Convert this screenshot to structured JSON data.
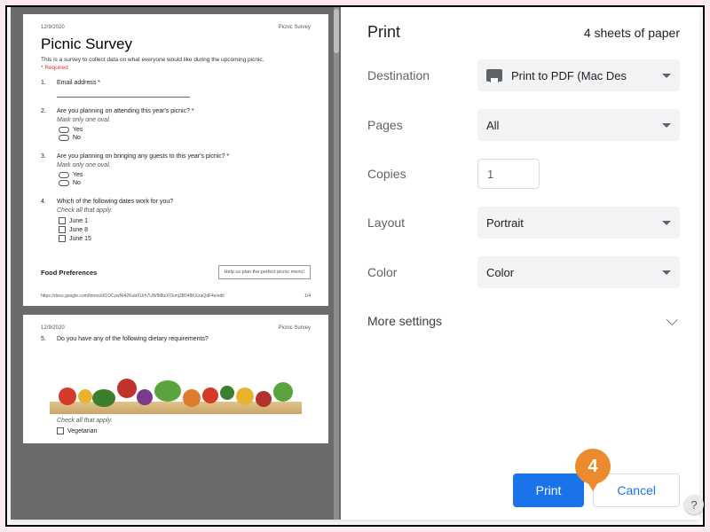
{
  "background_hint": "Are you planning on bringing any guests to this year's picnic?",
  "callout_number": "4",
  "preview": {
    "date": "12/9/2020",
    "doc_title": "Picnic Survey",
    "title": "Picnic Survey",
    "description": "This is a survey to collect data on what everyone would like during the upcoming picnic.",
    "required_note": "* Required",
    "page_url": "https://docs.google.com/forms/d/1OCzwNI42KubXUrh7UW9l8tzXCkmj3B048KXzaQdF4s/edit",
    "page_num_1": "1/4",
    "questions": [
      {
        "num": "1.",
        "text": "Email address *"
      },
      {
        "num": "2.",
        "text": "Are you planning on attending this year's picnic? *",
        "sub": "Mark only one oval.",
        "ovals": [
          "Yes",
          "No"
        ]
      },
      {
        "num": "3.",
        "text": "Are you planning on bringing any guests to this year's picnic? *",
        "sub": "Mark only one oval.",
        "ovals": [
          "Yes",
          "No"
        ]
      },
      {
        "num": "4.",
        "text": "Which of the following dates work for you?",
        "sub": "Check all that apply.",
        "checks": [
          "June 1",
          "June 8",
          "June 15"
        ]
      }
    ],
    "section_label": "Food Preferences",
    "section_hint": "Help us plan the perfect picnic menu!",
    "q5": {
      "num": "5.",
      "text": "Do you have any of the following dietary requirements?",
      "sub": "Check all that apply.",
      "opt": "Vegetarian"
    }
  },
  "print": {
    "title": "Print",
    "sheets": "4 sheets of paper",
    "rows": {
      "destination": {
        "label": "Destination",
        "value": "Print to PDF (Mac Des"
      },
      "pages": {
        "label": "Pages",
        "value": "All"
      },
      "copies": {
        "label": "Copies",
        "value": "1"
      },
      "layout": {
        "label": "Layout",
        "value": "Portrait"
      },
      "color": {
        "label": "Color",
        "value": "Color"
      }
    },
    "more": "More settings",
    "buttons": {
      "print": "Print",
      "cancel": "Cancel"
    }
  }
}
